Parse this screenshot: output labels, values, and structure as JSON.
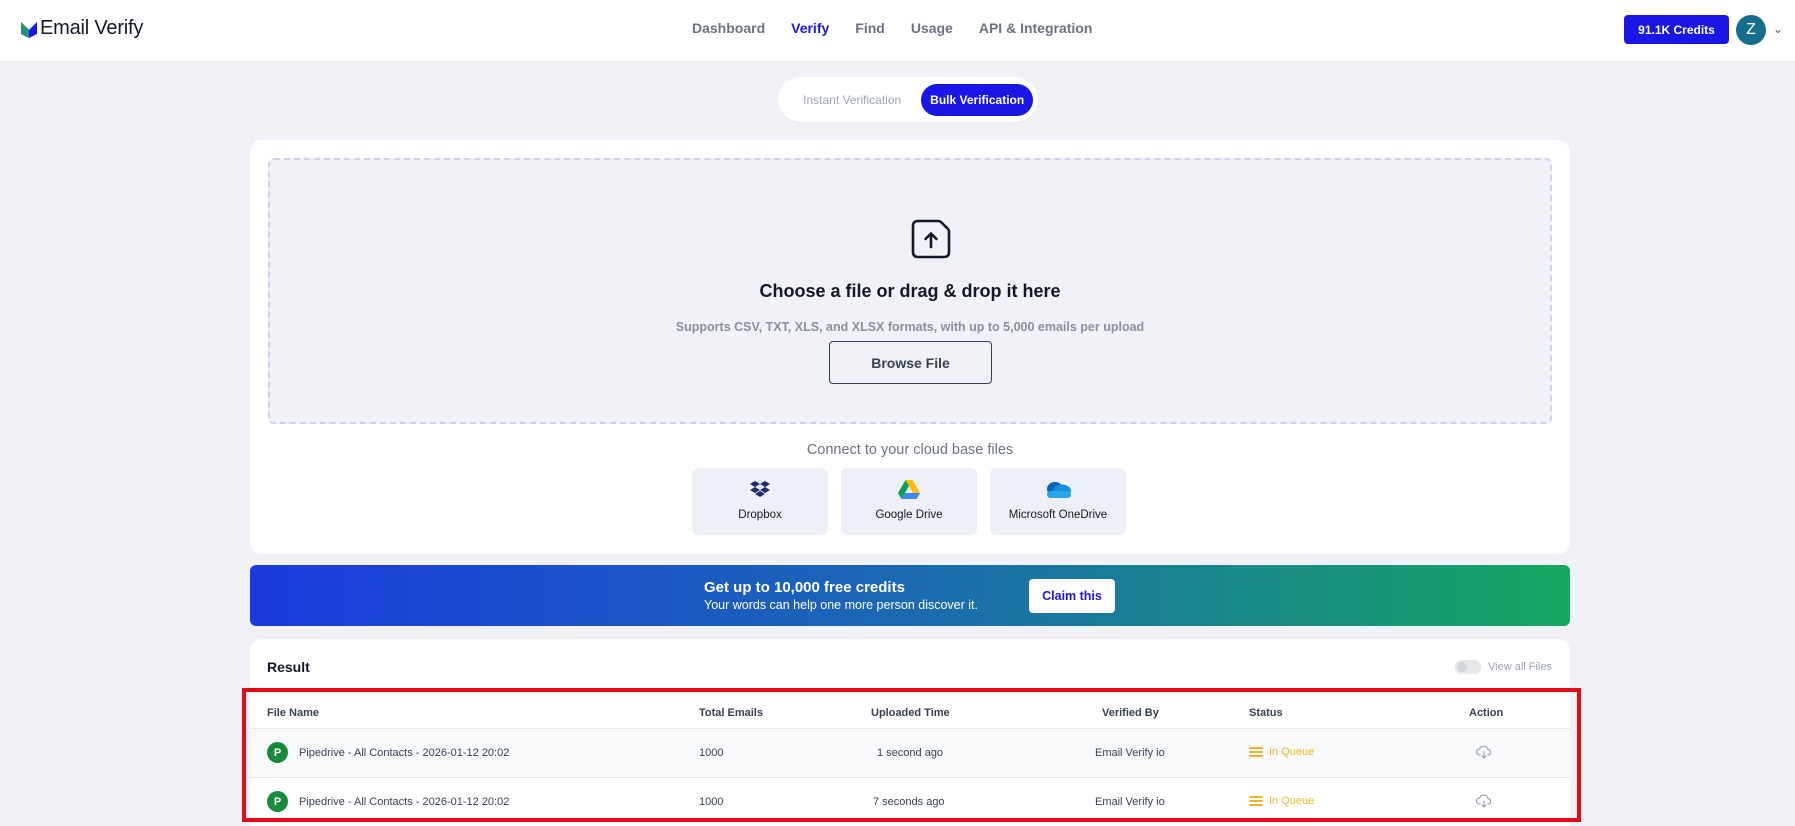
{
  "header": {
    "logo_text": "Email Verify",
    "nav": [
      {
        "label": "Dashboard",
        "active": false
      },
      {
        "label": "Verify",
        "active": true
      },
      {
        "label": "Find",
        "active": false
      },
      {
        "label": "Usage",
        "active": false
      },
      {
        "label": "API & Integration",
        "active": false
      }
    ],
    "credits_label": "91.1K Credits",
    "avatar_initial": "Z"
  },
  "mode_toggle": {
    "instant_label": "Instant Verification",
    "bulk_label": "Bulk Verification",
    "selected": "bulk"
  },
  "upload": {
    "title": "Choose a file or drag & drop it here",
    "subtitle": "Supports CSV, TXT, XLS, and XLSX formats, with up to 5,000 emails per upload",
    "browse_label": "Browse File",
    "cloud_title": "Connect to your cloud base files",
    "cloud_sources": [
      {
        "label": "Dropbox",
        "icon": "dropbox-icon"
      },
      {
        "label": "Google Drive",
        "icon": "google-drive-icon"
      },
      {
        "label": "Microsoft OneDrive",
        "icon": "onedrive-icon"
      }
    ]
  },
  "promo": {
    "title": "Get up to 10,000 free credits",
    "subtitle": "Your words can help one more person discover it.",
    "cta_label": "Claim this"
  },
  "results": {
    "title": "Result",
    "view_all_label": "View all Files",
    "view_all_enabled": false,
    "columns": [
      "File Name",
      "Total Emails",
      "Uploaded Time",
      "Verified By",
      "Status",
      "Action"
    ],
    "rows": [
      {
        "badge": "P",
        "file_name": "Pipedrive - All Contacts - 2026-01-12 20:02",
        "total_emails": "1000",
        "uploaded_time": "1 second ago",
        "verified_by": "Email Verify io",
        "status": "In Queue"
      },
      {
        "badge": "P",
        "file_name": "Pipedrive - All Contacts - 2026-01-12 20:02",
        "total_emails": "1000",
        "uploaded_time": "7 seconds ago",
        "verified_by": "Email Verify io",
        "status": "In Queue"
      }
    ]
  },
  "colors": {
    "accent": "#1a16e6",
    "status_queue": "#f0b429",
    "highlight": "#e50914"
  }
}
